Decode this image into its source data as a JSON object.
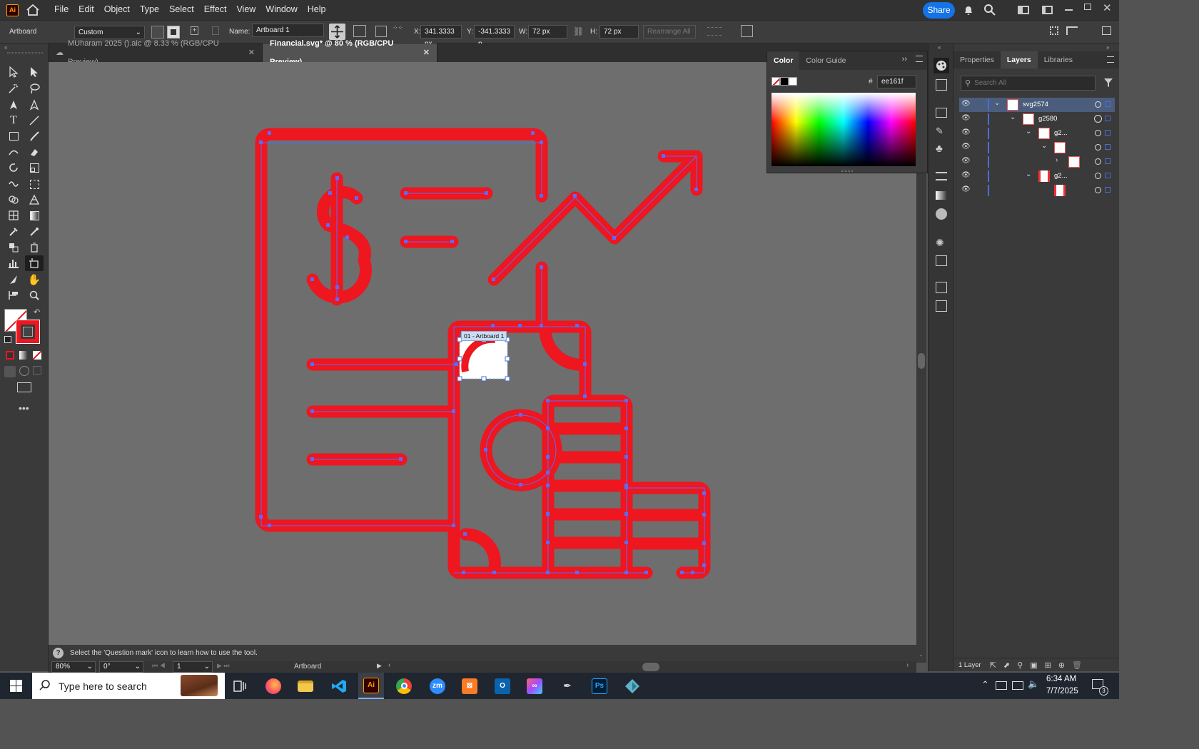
{
  "app": {
    "logo": "Ai",
    "brand_color": "#ff9a00",
    "bg_color": "#300000"
  },
  "menu": {
    "file": "File",
    "edit": "Edit",
    "object": "Object",
    "type": "Type",
    "select": "Select",
    "effect": "Effect",
    "view": "View",
    "window": "Window",
    "help": "Help"
  },
  "share_label": "Share",
  "control": {
    "tool_label": "Artboard",
    "preset": "Custom",
    "name_label": "Name:",
    "name_value": "Artboard 1",
    "x_label": "X:",
    "x_value": "341.3333 px",
    "y_label": "Y:",
    "y_value": "-341.3333 p",
    "w_label": "W:",
    "w_value": "72 px",
    "h_label": "H:",
    "h_value": "72 px",
    "rearrange": "Rearrange All"
  },
  "tabs": [
    {
      "label": "MUharam 2025 ().aic @ 8.33 % (RGB/CPU Preview)"
    },
    {
      "label": "Financial.svg* @ 80 % (RGB/CPU Preview)"
    }
  ],
  "artboard_tag": "01 - Artboard 1",
  "color_panel": {
    "tab1": "Color",
    "tab2": "Color Guide",
    "hex_label": "#",
    "hex_value": "ee161f"
  },
  "right_panel": {
    "tab_properties": "Properties",
    "tab_layers": "Layers",
    "tab_libraries": "Libraries",
    "search_placeholder": "Search All"
  },
  "layers": [
    {
      "name": "svg2574"
    },
    {
      "name": "g2580"
    },
    {
      "name": "g2..."
    },
    {
      "name": ""
    },
    {
      "name": ""
    },
    {
      "name": "g2..."
    },
    {
      "name": ""
    }
  ],
  "layers_footer": "1 Layer",
  "status_hint": "Select the 'Question mark' icon to learn how to use the tool.",
  "bottom": {
    "zoom": "80%",
    "rotation": "0°",
    "artboard_num": "1",
    "tool": "Artboard"
  },
  "taskbar": {
    "search_placeholder": "Type here to search",
    "time": "6:34 AM",
    "date": "7/7/2025",
    "notif_count": "3"
  },
  "colors": {
    "art_red": "#ee161f",
    "path_blue": "#5b6bff",
    "layer_bar": "#4a6fd6",
    "share_blue": "#1473e6"
  }
}
